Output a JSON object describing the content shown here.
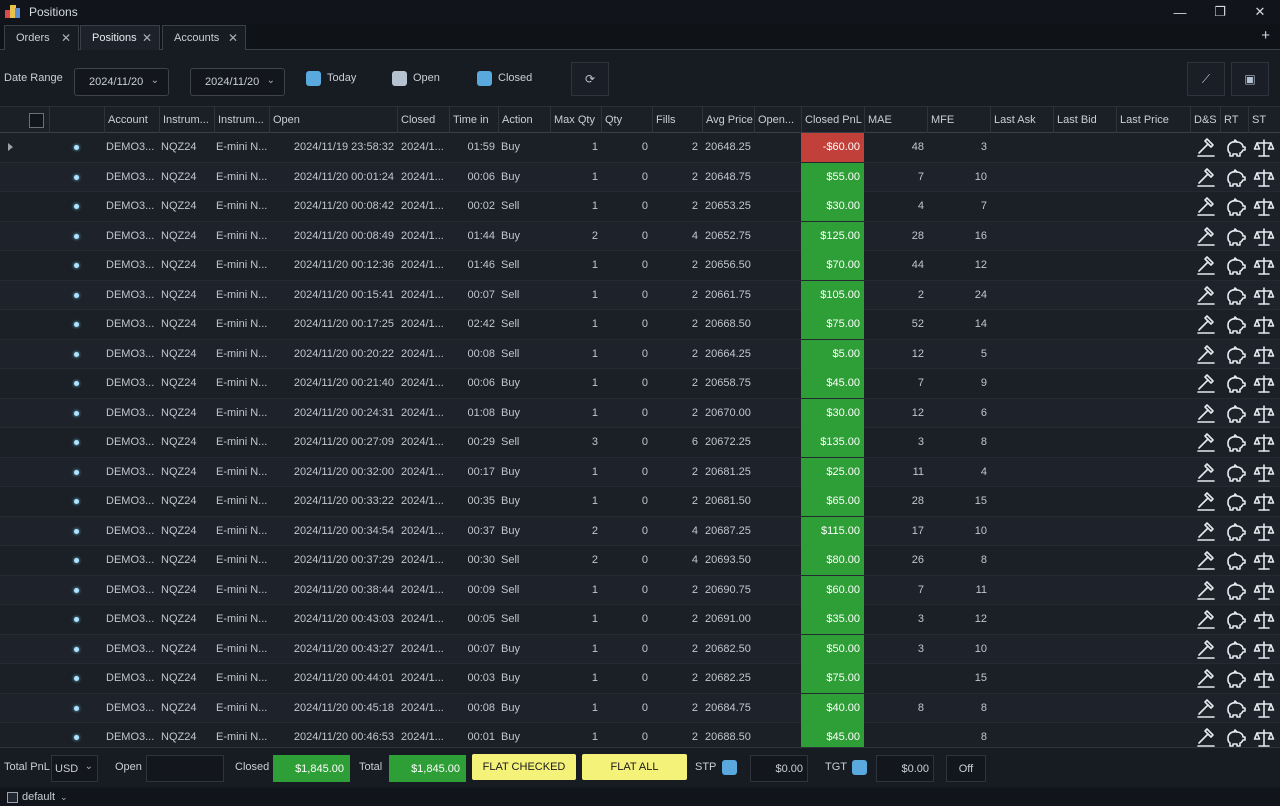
{
  "window": {
    "title": "Positions",
    "controls": [
      "—",
      "❐",
      "✕"
    ]
  },
  "tabs": [
    {
      "label": "Orders",
      "active": false
    },
    {
      "label": "Positions",
      "active": true
    },
    {
      "label": "Accounts",
      "active": false
    }
  ],
  "tab_add": "+",
  "toolbar": {
    "date_range_label": "Date Range",
    "date_from": "2024/11/20",
    "date_to": "2024/11/20",
    "today_label": "Today",
    "open_label": "Open",
    "closed_label": "Closed",
    "refresh_icon": "refresh-icon",
    "edit_icon": "wrench-icon",
    "save_icon": "save-icon"
  },
  "columns": [
    "",
    "",
    "Account",
    "Instrum...",
    "Instrum...",
    "Open",
    "Closed",
    "Time in",
    "Action",
    "Max Qty",
    "Qty",
    "Fills",
    "Avg Price",
    "Open...",
    "Closed PnL",
    "MAE",
    "MFE",
    "Last Ask",
    "Last Bid",
    "Last Price",
    "D&S",
    "RT",
    "ST"
  ],
  "rows": [
    {
      "account": "DEMO3...",
      "instrument": "NQZ24",
      "name": "E-mini N...",
      "open": "2024/11/19 23:58:32",
      "closed": "2024/1...",
      "time_in": "01:59",
      "action": "Buy",
      "max_qty": "1",
      "qty": "0",
      "fills": "2",
      "avg_price": "20648.25",
      "pnl": "-$60.00",
      "pnl_sign": "neg",
      "mae": "48",
      "mfe": "3"
    },
    {
      "account": "DEMO3...",
      "instrument": "NQZ24",
      "name": "E-mini N...",
      "open": "2024/11/20 00:01:24",
      "closed": "2024/1...",
      "time_in": "00:06",
      "action": "Buy",
      "max_qty": "1",
      "qty": "0",
      "fills": "2",
      "avg_price": "20648.75",
      "pnl": "$55.00",
      "pnl_sign": "pos",
      "mae": "7",
      "mfe": "10"
    },
    {
      "account": "DEMO3...",
      "instrument": "NQZ24",
      "name": "E-mini N...",
      "open": "2024/11/20 00:08:42",
      "closed": "2024/1...",
      "time_in": "00:02",
      "action": "Sell",
      "max_qty": "1",
      "qty": "0",
      "fills": "2",
      "avg_price": "20653.25",
      "pnl": "$30.00",
      "pnl_sign": "pos",
      "mae": "4",
      "mfe": "7"
    },
    {
      "account": "DEMO3...",
      "instrument": "NQZ24",
      "name": "E-mini N...",
      "open": "2024/11/20 00:08:49",
      "closed": "2024/1...",
      "time_in": "01:44",
      "action": "Buy",
      "max_qty": "2",
      "qty": "0",
      "fills": "4",
      "avg_price": "20652.75",
      "pnl": "$125.00",
      "pnl_sign": "pos",
      "mae": "28",
      "mfe": "16"
    },
    {
      "account": "DEMO3...",
      "instrument": "NQZ24",
      "name": "E-mini N...",
      "open": "2024/11/20 00:12:36",
      "closed": "2024/1...",
      "time_in": "01:46",
      "action": "Sell",
      "max_qty": "1",
      "qty": "0",
      "fills": "2",
      "avg_price": "20656.50",
      "pnl": "$70.00",
      "pnl_sign": "pos",
      "mae": "44",
      "mfe": "12"
    },
    {
      "account": "DEMO3...",
      "instrument": "NQZ24",
      "name": "E-mini N...",
      "open": "2024/11/20 00:15:41",
      "closed": "2024/1...",
      "time_in": "00:07",
      "action": "Sell",
      "max_qty": "1",
      "qty": "0",
      "fills": "2",
      "avg_price": "20661.75",
      "pnl": "$105.00",
      "pnl_sign": "pos",
      "mae": "2",
      "mfe": "24"
    },
    {
      "account": "DEMO3...",
      "instrument": "NQZ24",
      "name": "E-mini N...",
      "open": "2024/11/20 00:17:25",
      "closed": "2024/1...",
      "time_in": "02:42",
      "action": "Sell",
      "max_qty": "1",
      "qty": "0",
      "fills": "2",
      "avg_price": "20668.50",
      "pnl": "$75.00",
      "pnl_sign": "pos",
      "mae": "52",
      "mfe": "14"
    },
    {
      "account": "DEMO3...",
      "instrument": "NQZ24",
      "name": "E-mini N...",
      "open": "2024/11/20 00:20:22",
      "closed": "2024/1...",
      "time_in": "00:08",
      "action": "Sell",
      "max_qty": "1",
      "qty": "0",
      "fills": "2",
      "avg_price": "20664.25",
      "pnl": "$5.00",
      "pnl_sign": "pos",
      "mae": "12",
      "mfe": "5"
    },
    {
      "account": "DEMO3...",
      "instrument": "NQZ24",
      "name": "E-mini N...",
      "open": "2024/11/20 00:21:40",
      "closed": "2024/1...",
      "time_in": "00:06",
      "action": "Buy",
      "max_qty": "1",
      "qty": "0",
      "fills": "2",
      "avg_price": "20658.75",
      "pnl": "$45.00",
      "pnl_sign": "pos",
      "mae": "7",
      "mfe": "9"
    },
    {
      "account": "DEMO3...",
      "instrument": "NQZ24",
      "name": "E-mini N...",
      "open": "2024/11/20 00:24:31",
      "closed": "2024/1...",
      "time_in": "01:08",
      "action": "Buy",
      "max_qty": "1",
      "qty": "0",
      "fills": "2",
      "avg_price": "20670.00",
      "pnl": "$30.00",
      "pnl_sign": "pos",
      "mae": "12",
      "mfe": "6"
    },
    {
      "account": "DEMO3...",
      "instrument": "NQZ24",
      "name": "E-mini N...",
      "open": "2024/11/20 00:27:09",
      "closed": "2024/1...",
      "time_in": "00:29",
      "action": "Sell",
      "max_qty": "3",
      "qty": "0",
      "fills": "6",
      "avg_price": "20672.25",
      "pnl": "$135.00",
      "pnl_sign": "pos",
      "mae": "3",
      "mfe": "8"
    },
    {
      "account": "DEMO3...",
      "instrument": "NQZ24",
      "name": "E-mini N...",
      "open": "2024/11/20 00:32:00",
      "closed": "2024/1...",
      "time_in": "00:17",
      "action": "Buy",
      "max_qty": "1",
      "qty": "0",
      "fills": "2",
      "avg_price": "20681.25",
      "pnl": "$25.00",
      "pnl_sign": "pos",
      "mae": "11",
      "mfe": "4"
    },
    {
      "account": "DEMO3...",
      "instrument": "NQZ24",
      "name": "E-mini N...",
      "open": "2024/11/20 00:33:22",
      "closed": "2024/1...",
      "time_in": "00:35",
      "action": "Buy",
      "max_qty": "1",
      "qty": "0",
      "fills": "2",
      "avg_price": "20681.50",
      "pnl": "$65.00",
      "pnl_sign": "pos",
      "mae": "28",
      "mfe": "15"
    },
    {
      "account": "DEMO3...",
      "instrument": "NQZ24",
      "name": "E-mini N...",
      "open": "2024/11/20 00:34:54",
      "closed": "2024/1...",
      "time_in": "00:37",
      "action": "Buy",
      "max_qty": "2",
      "qty": "0",
      "fills": "4",
      "avg_price": "20687.25",
      "pnl": "$115.00",
      "pnl_sign": "pos",
      "mae": "17",
      "mfe": "10"
    },
    {
      "account": "DEMO3...",
      "instrument": "NQZ24",
      "name": "E-mini N...",
      "open": "2024/11/20 00:37:29",
      "closed": "2024/1...",
      "time_in": "00:30",
      "action": "Sell",
      "max_qty": "2",
      "qty": "0",
      "fills": "4",
      "avg_price": "20693.50",
      "pnl": "$80.00",
      "pnl_sign": "pos",
      "mae": "26",
      "mfe": "8"
    },
    {
      "account": "DEMO3...",
      "instrument": "NQZ24",
      "name": "E-mini N...",
      "open": "2024/11/20 00:38:44",
      "closed": "2024/1...",
      "time_in": "00:09",
      "action": "Sell",
      "max_qty": "1",
      "qty": "0",
      "fills": "2",
      "avg_price": "20690.75",
      "pnl": "$60.00",
      "pnl_sign": "pos",
      "mae": "7",
      "mfe": "11"
    },
    {
      "account": "DEMO3...",
      "instrument": "NQZ24",
      "name": "E-mini N...",
      "open": "2024/11/20 00:43:03",
      "closed": "2024/1...",
      "time_in": "00:05",
      "action": "Sell",
      "max_qty": "1",
      "qty": "0",
      "fills": "2",
      "avg_price": "20691.00",
      "pnl": "$35.00",
      "pnl_sign": "pos",
      "mae": "3",
      "mfe": "12"
    },
    {
      "account": "DEMO3...",
      "instrument": "NQZ24",
      "name": "E-mini N...",
      "open": "2024/11/20 00:43:27",
      "closed": "2024/1...",
      "time_in": "00:07",
      "action": "Buy",
      "max_qty": "1",
      "qty": "0",
      "fills": "2",
      "avg_price": "20682.50",
      "pnl": "$50.00",
      "pnl_sign": "pos",
      "mae": "3",
      "mfe": "10"
    },
    {
      "account": "DEMO3...",
      "instrument": "NQZ24",
      "name": "E-mini N...",
      "open": "2024/11/20 00:44:01",
      "closed": "2024/1...",
      "time_in": "00:03",
      "action": "Buy",
      "max_qty": "1",
      "qty": "0",
      "fills": "2",
      "avg_price": "20682.25",
      "pnl": "$75.00",
      "pnl_sign": "pos",
      "mae": "",
      "mfe": "15"
    },
    {
      "account": "DEMO3...",
      "instrument": "NQZ24",
      "name": "E-mini N...",
      "open": "2024/11/20 00:45:18",
      "closed": "2024/1...",
      "time_in": "00:08",
      "action": "Buy",
      "max_qty": "1",
      "qty": "0",
      "fills": "2",
      "avg_price": "20684.75",
      "pnl": "$40.00",
      "pnl_sign": "pos",
      "mae": "8",
      "mfe": "8"
    },
    {
      "account": "DEMO3...",
      "instrument": "NQZ24",
      "name": "E-mini N...",
      "open": "2024/11/20 00:46:53",
      "closed": "2024/1...",
      "time_in": "00:01",
      "action": "Buy",
      "max_qty": "1",
      "qty": "0",
      "fills": "2",
      "avg_price": "20688.50",
      "pnl": "$45.00",
      "pnl_sign": "pos",
      "mae": "",
      "mfe": "8"
    }
  ],
  "row_icons": [
    "hammer-icon",
    "piggy-bank-icon",
    "scale-icon"
  ],
  "footer": {
    "total_pnl_label": "Total PnL",
    "currency": "USD",
    "open_label": "Open",
    "open_value": "",
    "closed_label": "Closed",
    "closed_value": "$1,845.00",
    "total_label": "Total",
    "total_value": "$1,845.00",
    "flat_checked_label": "FLAT CHECKED",
    "flat_all_label": "FLAT ALL",
    "stp_label": "STP",
    "stp_value": "$0.00",
    "tgt_label": "TGT",
    "tgt_value": "$0.00",
    "off_label": "Off"
  },
  "status": {
    "workspace": "default"
  },
  "colors": {
    "profit": "#2e9e36",
    "loss": "#c2403a",
    "flat_button": "#f5f27a",
    "checkbox_on": "#5aa9de"
  }
}
